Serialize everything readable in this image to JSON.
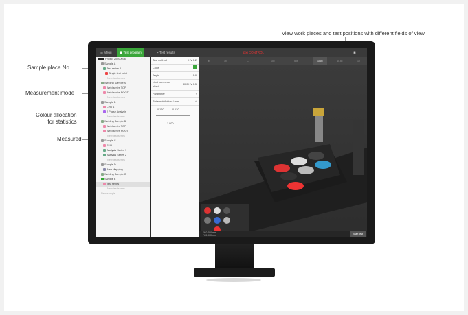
{
  "callouts": {
    "top": "View work pieces and test positions with different fields of view",
    "sample_place": "Sample place No.",
    "measurement_mode": "Measurement mode",
    "colour_line1": "Colour allocation",
    "colour_line2": "for statistics",
    "measured": "Measured"
  },
  "topbar": {
    "menu": "Menu",
    "test_program": "Test program",
    "test_results": "Test results",
    "brand": "pixi CONTROL"
  },
  "toolbar2": [
    "1x",
    "--",
    "10x",
    "50x",
    "100x",
    "40.5x",
    "1x"
  ],
  "tree": {
    "project": "Project 20000036",
    "rows": [
      {
        "label": "Sample A",
        "indent": 3,
        "color": "#999"
      },
      {
        "label": "Test series 1",
        "indent": 6,
        "color": "#6a8"
      },
      {
        "label": "Single test point",
        "indent": 9,
        "color": "#e44"
      },
      {
        "label": "New test series",
        "indent": 12,
        "color": ""
      },
      {
        "label": "Welding Sample A",
        "indent": 3,
        "color": "#8a8"
      },
      {
        "label": "Weld series TOP",
        "indent": 6,
        "color": "#e8a"
      },
      {
        "label": "Weld series ROOT",
        "indent": 6,
        "color": "#e8a"
      },
      {
        "label": "New test series",
        "indent": 12,
        "color": ""
      },
      {
        "label": "Sample B",
        "indent": 3,
        "color": "#999"
      },
      {
        "label": "CHD 1",
        "indent": 6,
        "color": "#e8a"
      },
      {
        "label": "2 Phase Analysis",
        "indent": 6,
        "color": "#a6e"
      },
      {
        "label": "New test series",
        "indent": 12,
        "color": ""
      },
      {
        "label": "Welding Sample B",
        "indent": 3,
        "color": "#8a8"
      },
      {
        "label": "Weld series TOP",
        "indent": 6,
        "color": "#e8a"
      },
      {
        "label": "Weld series ROOT",
        "indent": 6,
        "color": "#e8a"
      },
      {
        "label": "New test series",
        "indent": 12,
        "color": ""
      },
      {
        "label": "Sample C",
        "indent": 3,
        "color": "#999"
      },
      {
        "label": "CHD",
        "indent": 6,
        "color": "#e8a"
      },
      {
        "label": "Analysis Series 1",
        "indent": 6,
        "color": "#6a8"
      },
      {
        "label": "Analysis Series 2",
        "indent": 6,
        "color": "#6a8"
      },
      {
        "label": "New test series",
        "indent": 12,
        "color": ""
      },
      {
        "label": "Sample D",
        "indent": 3,
        "color": "#999"
      },
      {
        "label": "Area Mapping",
        "indent": 6,
        "color": "#88a"
      },
      {
        "label": "Welding Sample C",
        "indent": 3,
        "color": "#8a8"
      },
      {
        "label": "Sample E",
        "indent": 3,
        "color": "#3a3"
      },
      {
        "label": "Test series",
        "indent": 6,
        "color": "#e8a"
      },
      {
        "label": "New test series",
        "indent": 12,
        "color": ""
      },
      {
        "label": "New sample",
        "indent": 3,
        "color": ""
      }
    ]
  },
  "panel": {
    "test_method_label": "Test method",
    "test_method_value": "HV 0.2",
    "color_label": "Color",
    "color_value": "#3aa63a",
    "angle_label": "Angle",
    "angle_value": "0.0",
    "limit_label": "Limit hardness",
    "limit_sub": "offset",
    "limit_value": "80.0",
    "limit_unit": "HV 0.5",
    "parameter_label": "Parameter",
    "pattern_label": "Pattern definition / mm",
    "pattern_a": "0.120",
    "pattern_b": "0.120",
    "pattern_c": "1.000"
  },
  "status": {
    "x": "0.000",
    "y": "0.000",
    "unit": "mm",
    "start": "Start test"
  }
}
